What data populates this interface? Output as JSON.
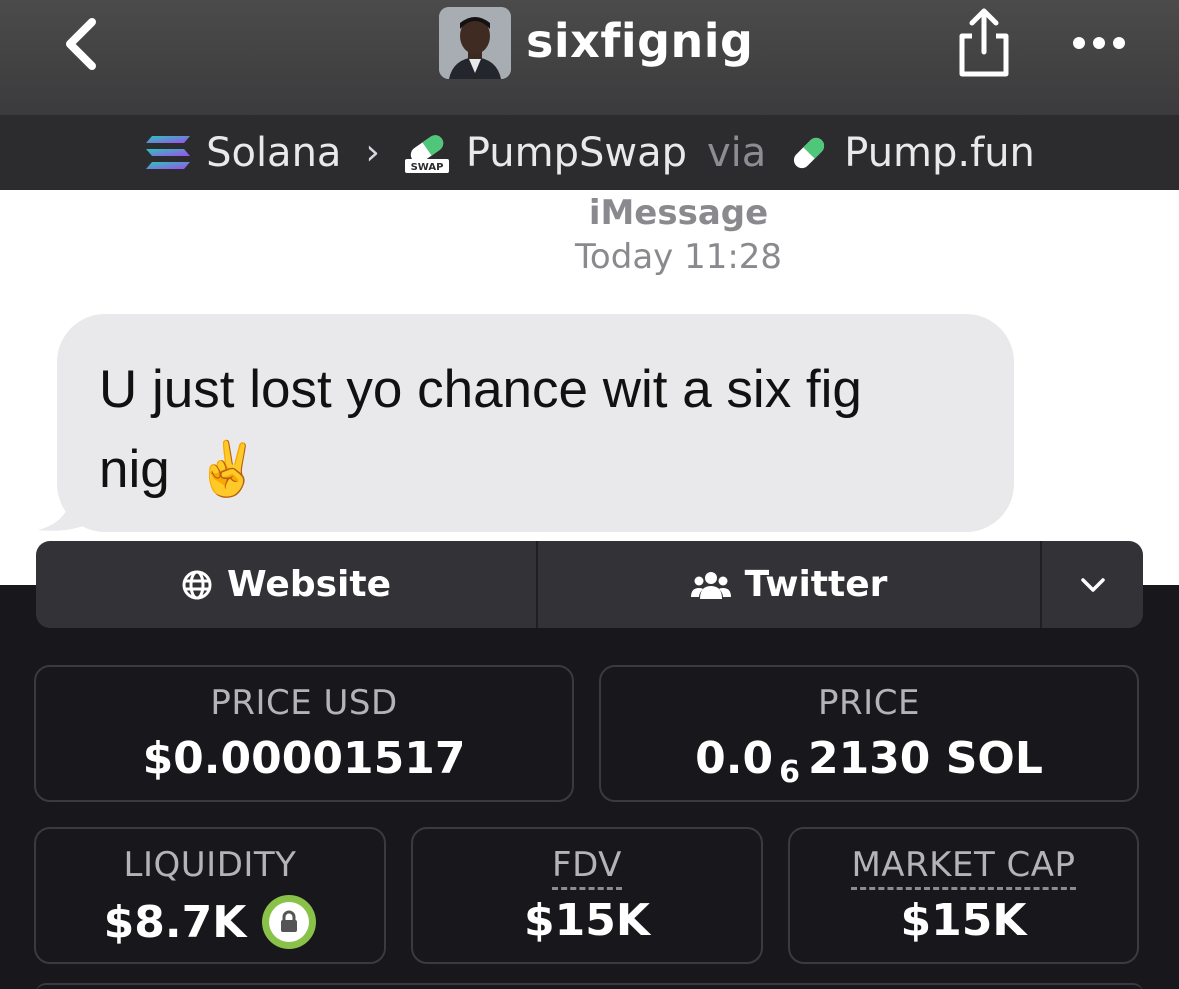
{
  "header": {
    "channel_name": "sixfignig",
    "icons": [
      "chevron-left-icon",
      "avatar",
      "share-icon",
      "more-icon"
    ]
  },
  "pair": {
    "chain": "Solana",
    "dex": "PumpSwap",
    "dex_badge": "SWAP",
    "via_label": "via",
    "launchpad": "Pump.fun"
  },
  "message": {
    "service": "iMessage",
    "time": "Today 11:28",
    "text_line1": "U just lost yo chance wit a six fig",
    "text_line2": "nig",
    "emoji": "✌️"
  },
  "links": {
    "website_label": "Website",
    "twitter_label": "Twitter"
  },
  "stats": {
    "price_usd": {
      "label": "PRICE USD",
      "value": "$0.00001517"
    },
    "price": {
      "label": "PRICE",
      "prefix": "0.0",
      "subscript": "6",
      "suffix": "2130 SOL"
    },
    "liquidity": {
      "label": "LIQUIDITY",
      "value": "$8.7K"
    },
    "fdv": {
      "label": "FDV",
      "value": "$15K"
    },
    "market_cap": {
      "label": "MARKET CAP",
      "value": "$15K"
    }
  },
  "colors": {
    "background": "#17171c",
    "card_border": "#3a3a40",
    "link_bar": "#323237",
    "lock_badge": "#8ac249",
    "bubble": "#e9e9eb"
  }
}
